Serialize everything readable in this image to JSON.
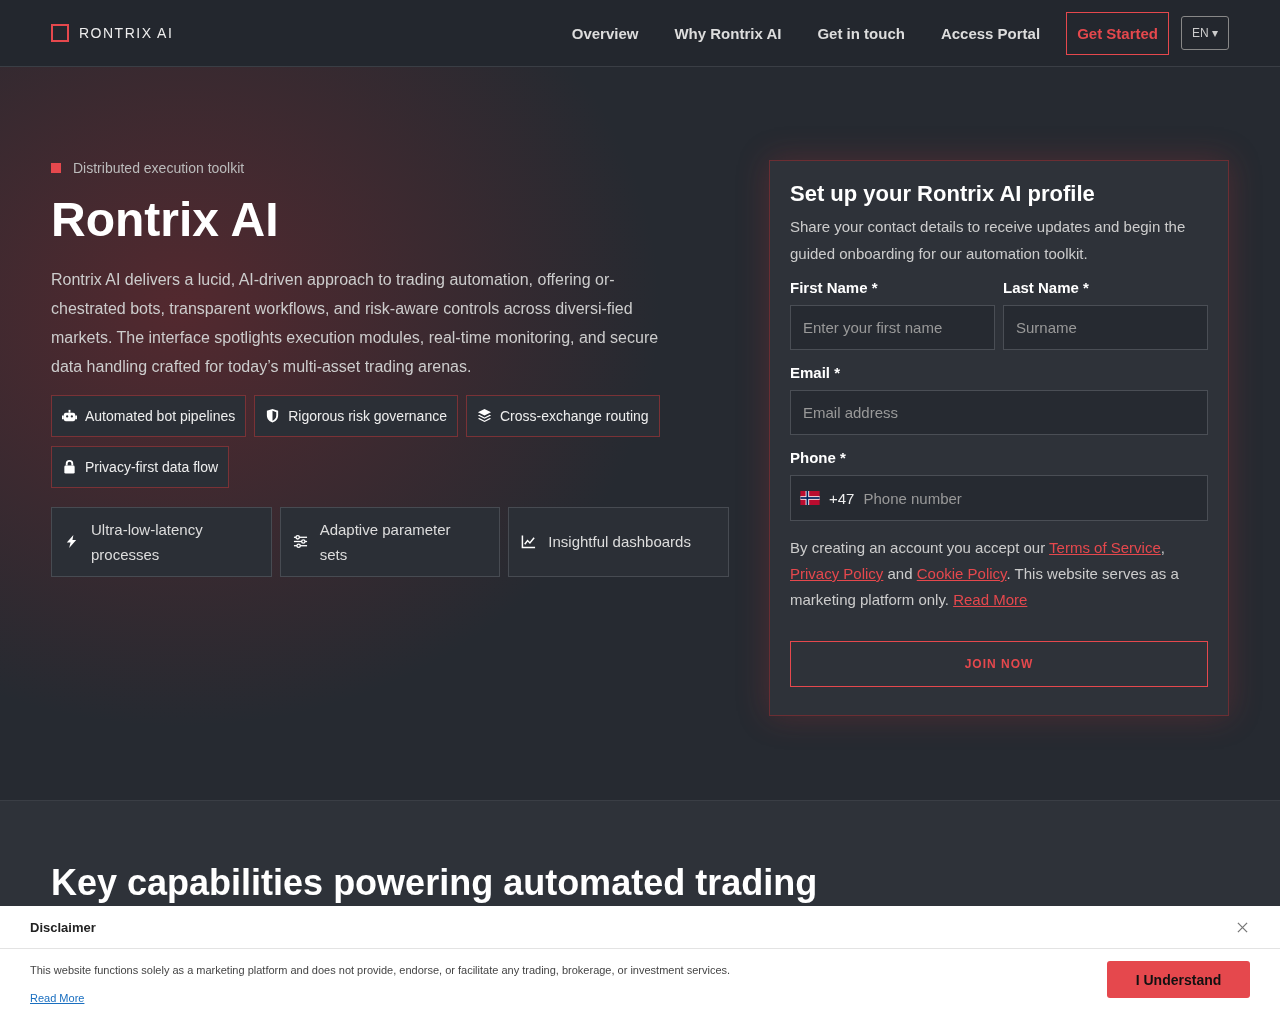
{
  "header": {
    "brand": "RONTRIX AI",
    "nav": [
      {
        "label": "Overview",
        "kind": "link"
      },
      {
        "label": "Why Rontrix AI",
        "kind": "link"
      },
      {
        "label": "Get in touch",
        "kind": "link"
      },
      {
        "label": "Access Portal",
        "kind": "link"
      },
      {
        "label": "Get Started",
        "kind": "cta"
      }
    ],
    "language": "EN ▾"
  },
  "hero": {
    "eyebrow": "Distributed execution toolkit",
    "title": "Rontrix AI",
    "description": "Rontrix AI delivers a lucid, AI-driven approach to trading automation, offering or-chestrated bots, transparent workflows, and risk-aware controls across diversi-fied markets. The interface spotlights execution modules, real-time monitoring, and secure data handling crafted for today’s multi-asset trading arenas.",
    "tags": [
      {
        "label": "Automated bot pipelines",
        "kind": "robot"
      },
      {
        "label": "Rigorous risk governance",
        "kind": "shield"
      },
      {
        "label": "Cross-exchange routing",
        "kind": "layers"
      },
      {
        "label": "Privacy-first data flow",
        "kind": "lock"
      }
    ],
    "features": [
      {
        "label": "Ultra-low-latency processes",
        "kind": "bolt"
      },
      {
        "label": "Adaptive parameter sets",
        "kind": "sliders"
      },
      {
        "label": "Insightful dashboards",
        "kind": "chart"
      }
    ]
  },
  "form": {
    "title": "Set up your Rontrix AI profile",
    "subtitle": "Share your contact details to receive updates and begin the guided onboarding for our automation toolkit.",
    "first_name": {
      "label": "First Name *",
      "placeholder": "Enter your first name"
    },
    "last_name": {
      "label": "Last Name *",
      "placeholder": "Surname"
    },
    "email": {
      "label": "Email *",
      "placeholder": "Email address"
    },
    "phone": {
      "label": "Phone *",
      "code": "+47",
      "placeholder": "Phone number"
    },
    "consent": [
      {
        "kind": "text",
        "text": "By creating an account you accept our "
      },
      {
        "kind": "link",
        "text": "Terms of Service"
      },
      {
        "kind": "text",
        "text": ", "
      },
      {
        "kind": "link",
        "text": "Privacy Policy"
      },
      {
        "kind": "text",
        "text": " and "
      },
      {
        "kind": "link",
        "text": "Cookie Policy"
      },
      {
        "kind": "text",
        "text": ". This website serves as a marketing platform only. "
      },
      {
        "kind": "link",
        "text": "Read More"
      }
    ],
    "submit": "JOIN NOW"
  },
  "capabilities": {
    "title": "Key capabilities powering automated trading"
  },
  "disclaimer": {
    "title": "Disclaimer",
    "text": "This website functions solely as a marketing platform and does not provide, endorse, or facilitate any trading, brokerage, or investment services.",
    "link": "Read More",
    "button": "I Understand"
  }
}
